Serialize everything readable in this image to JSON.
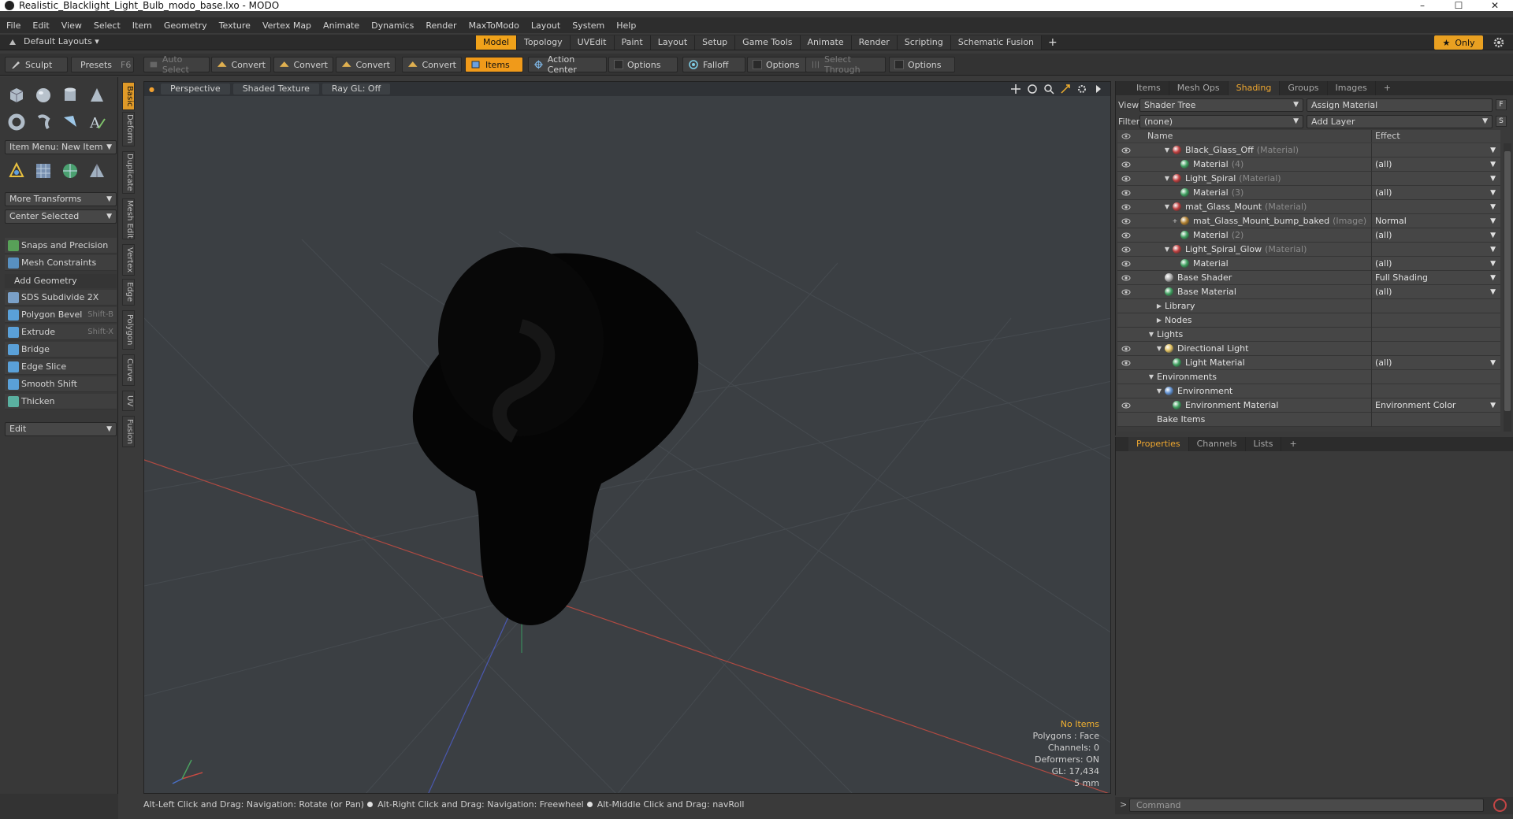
{
  "window": {
    "title": "Realistic_Blacklight_Light_Bulb_modo_base.lxo - MODO",
    "controls": {
      "minimize": "–",
      "maximize": "☐",
      "close": "✕"
    }
  },
  "menu": [
    "File",
    "Edit",
    "View",
    "Select",
    "Item",
    "Geometry",
    "Texture",
    "Vertex Map",
    "Animate",
    "Dynamics",
    "Render",
    "MaxToModo",
    "Layout",
    "System",
    "Help"
  ],
  "layout_bar": {
    "default_layouts": "Default Layouts ▾",
    "tabs": [
      {
        "label": "Model",
        "active": true
      },
      {
        "label": "Topology",
        "active": false
      },
      {
        "label": "UVEdit",
        "active": false
      },
      {
        "label": "Paint",
        "active": false
      },
      {
        "label": "Layout",
        "active": false
      },
      {
        "label": "Setup",
        "active": false
      },
      {
        "label": "Game Tools",
        "active": false
      },
      {
        "label": "Animate",
        "active": false
      },
      {
        "label": "Render",
        "active": false
      },
      {
        "label": "Scripting",
        "active": false
      },
      {
        "label": "Schematic Fusion",
        "active": false
      }
    ],
    "plus": "+",
    "only_label": "Only",
    "star": "★"
  },
  "toolbar": {
    "sculpt": "Sculpt",
    "presets": "Presets",
    "presets_key": "F6",
    "auto_select": "Auto Select",
    "convert": "Convert",
    "items": "Items",
    "action_center": "Action Center",
    "options": "Options",
    "falloff": "Falloff",
    "select_through": "Select Through"
  },
  "left_panel": {
    "item_menu": "Item Menu: New Item",
    "more_transforms": "More Transforms",
    "center_selected": "Center Selected",
    "snaps": "Snaps and Precision",
    "mesh_constraints": "Mesh Constraints",
    "add_geometry": "Add Geometry",
    "tools": [
      {
        "label": "SDS Subdivide 2X",
        "key": "",
        "color": "#7aa0c8"
      },
      {
        "label": "Polygon Bevel",
        "key": "Shift-B",
        "color": "#5aa0d8"
      },
      {
        "label": "Extrude",
        "key": "Shift-X",
        "color": "#5aa0d8"
      },
      {
        "label": "Bridge",
        "key": "",
        "color": "#5aa0d8"
      },
      {
        "label": "Edge Slice",
        "key": "",
        "color": "#5aa0d8"
      },
      {
        "label": "Smooth Shift",
        "key": "",
        "color": "#5aa0d8"
      },
      {
        "label": "Thicken",
        "key": "",
        "color": "#5ab0a0"
      }
    ],
    "edit": "Edit",
    "vtabs": [
      "Basic",
      "Deform",
      "Duplicate",
      "Mesh Edit",
      "Vertex",
      "Edge",
      "Polygon",
      "Curve",
      "UV",
      "Fusion"
    ]
  },
  "viewport": {
    "perspective": "Perspective",
    "shaded": "Shaded Texture",
    "raygl": "Ray GL: Off",
    "info": {
      "items": "No Items",
      "polygons": "Polygons : Face",
      "channels": "Channels: 0",
      "deformers": "Deformers: ON",
      "gl": "GL: 17,434",
      "scale": "5 mm"
    }
  },
  "status": {
    "hint1": "Alt-Left Click and Drag: Navigation: Rotate (or Pan)",
    "hint2": "Alt-Right Click and Drag: Navigation: Freewheel",
    "hint3": "Alt-Middle Click and Drag: navRoll"
  },
  "right_panel": {
    "tabs": [
      {
        "label": "Items",
        "active": false
      },
      {
        "label": "Mesh Ops",
        "active": false
      },
      {
        "label": "Shading",
        "active": true
      },
      {
        "label": "Groups",
        "active": false
      },
      {
        "label": "Images",
        "active": false
      }
    ],
    "plus": "+",
    "view_label": "View",
    "view_value": "Shader Tree",
    "assign_material": "Assign Material",
    "filter_label": "Filter",
    "filter_value": "(none)",
    "add_layer": "Add Layer",
    "f_btn": "F",
    "s_btn": "S",
    "col_name": "Name",
    "col_effect": "Effect",
    "rows": [
      {
        "name": "Black_Glass_Off",
        "kind": "(Material)",
        "effect": "",
        "indent": 3,
        "ball": "#c04040",
        "exp": "▼",
        "eye": true,
        "dark": false
      },
      {
        "name": "Material",
        "kind": "(4)",
        "effect": "(all)",
        "indent": 4,
        "ball": "#40a060",
        "exp": "",
        "eye": true,
        "dark": false
      },
      {
        "name": "Light_Spiral",
        "kind": "(Material)",
        "effect": "",
        "indent": 3,
        "ball": "#c04040",
        "exp": "▼",
        "eye": true,
        "dark": false
      },
      {
        "name": "Material",
        "kind": "(3)",
        "effect": "(all)",
        "indent": 4,
        "ball": "#40a060",
        "exp": "",
        "eye": true,
        "dark": false
      },
      {
        "name": "mat_Glass_Mount",
        "kind": "(Material)",
        "effect": "",
        "indent": 3,
        "ball": "#c04040",
        "exp": "▼",
        "eye": true,
        "dark": false
      },
      {
        "name": "mat_Glass_Mount_bump_baked",
        "kind": "(Image)",
        "effect": "Normal",
        "indent": 4,
        "ball": "#b08030",
        "exp": "+",
        "eye": true,
        "dark": false
      },
      {
        "name": "Material",
        "kind": "(2)",
        "effect": "(all)",
        "indent": 4,
        "ball": "#40a060",
        "exp": "",
        "eye": true,
        "dark": false
      },
      {
        "name": "Light_Spiral_Glow",
        "kind": "(Material)",
        "effect": "",
        "indent": 3,
        "ball": "#c04040",
        "exp": "▼",
        "eye": true,
        "dark": false
      },
      {
        "name": "Material",
        "kind": "",
        "effect": "(all)",
        "indent": 4,
        "ball": "#40a060",
        "exp": "",
        "eye": true,
        "dark": false
      },
      {
        "name": "Base Shader",
        "kind": "",
        "effect": "Full Shading",
        "indent": 2,
        "ball": "#b0b0b0",
        "exp": "",
        "eye": true,
        "dark": false
      },
      {
        "name": "Base Material",
        "kind": "",
        "effect": "(all)",
        "indent": 2,
        "ball": "#40a060",
        "exp": "",
        "eye": true,
        "dark": false
      },
      {
        "name": "Library",
        "kind": "",
        "effect": "",
        "indent": 2,
        "ball": "",
        "exp": "▶",
        "eye": false,
        "dark": false
      },
      {
        "name": "Nodes",
        "kind": "",
        "effect": "",
        "indent": 2,
        "ball": "",
        "exp": "▶",
        "eye": false,
        "dark": false
      },
      {
        "name": "Lights",
        "kind": "",
        "effect": "",
        "indent": 1,
        "ball": "",
        "exp": "▼",
        "eye": false,
        "dark": false
      },
      {
        "name": "Directional Light",
        "kind": "",
        "effect": "",
        "indent": 2,
        "ball": "#e0c060",
        "exp": "▼",
        "eye": true,
        "dark": false
      },
      {
        "name": "Light Material",
        "kind": "",
        "effect": "(all)",
        "indent": 3,
        "ball": "#40a060",
        "exp": "",
        "eye": true,
        "dark": false
      },
      {
        "name": "Environments",
        "kind": "",
        "effect": "",
        "indent": 1,
        "ball": "",
        "exp": "▼",
        "eye": false,
        "dark": false
      },
      {
        "name": "Environment",
        "kind": "",
        "effect": "",
        "indent": 2,
        "ball": "#6090d0",
        "exp": "▼",
        "eye": false,
        "dark": false
      },
      {
        "name": "Environment Material",
        "kind": "",
        "effect": "Environment Color",
        "indent": 3,
        "ball": "#40a060",
        "exp": "",
        "eye": true,
        "dark": false
      },
      {
        "name": "Bake Items",
        "kind": "",
        "effect": "",
        "indent": 1,
        "ball": "",
        "exp": "",
        "eye": false,
        "dark": false
      }
    ]
  },
  "properties_panel": {
    "tabs": [
      {
        "label": "Properties",
        "active": true
      },
      {
        "label": "Channels",
        "active": false
      },
      {
        "label": "Lists",
        "active": false
      }
    ],
    "plus": "+"
  },
  "command": {
    "placeholder": "Command",
    "arrow": ">"
  }
}
